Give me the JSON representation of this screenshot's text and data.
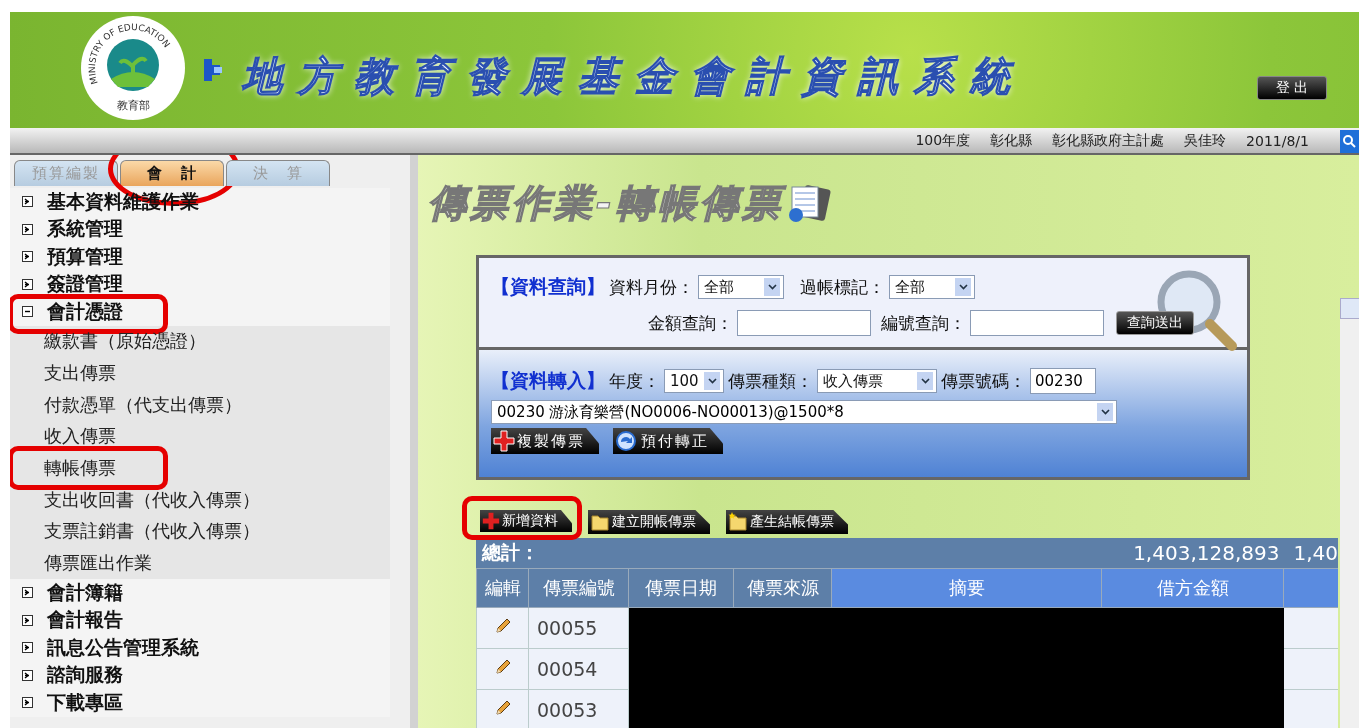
{
  "header": {
    "logo_ring_text": "MINISTRY OF EDUCATION",
    "logo_bottom_text": "教育部",
    "title": "地方教育發展基金會計資訊系統",
    "logout_button": "登 出"
  },
  "info_bar": [
    "100年度",
    "彰化縣",
    "彰化縣政府主計處",
    "吳佳玲",
    "2011/8/1"
  ],
  "tabs": [
    {
      "label": "預算編製",
      "selected": false,
      "circled": false
    },
    {
      "label": "會　計",
      "selected": true,
      "circled": true
    },
    {
      "label": "決　算",
      "selected": false,
      "circled": false
    }
  ],
  "menu": [
    {
      "label": "基本資料維護作業",
      "expanded": false,
      "boxed": false
    },
    {
      "label": "系統管理",
      "expanded": false,
      "boxed": false
    },
    {
      "label": "預算管理",
      "expanded": false,
      "boxed": false
    },
    {
      "label": "簽證管理",
      "expanded": false,
      "boxed": false
    },
    {
      "label": "會計憑證",
      "expanded": true,
      "boxed": true,
      "children": [
        {
          "label": "繳款書（原始憑證）",
          "boxed": false
        },
        {
          "label": "支出傳票",
          "boxed": false
        },
        {
          "label": "付款憑單（代支出傳票）",
          "boxed": false
        },
        {
          "label": "收入傳票",
          "boxed": false
        },
        {
          "label": "轉帳傳票",
          "boxed": true
        },
        {
          "label": "支出收回書（代收入傳票）",
          "boxed": false
        },
        {
          "label": "支票註銷書（代收入傳票）",
          "boxed": false
        },
        {
          "label": "傳票匯出作業",
          "boxed": false
        }
      ]
    },
    {
      "label": "會計簿籍",
      "expanded": false,
      "boxed": false
    },
    {
      "label": "會計報告",
      "expanded": false,
      "boxed": false
    },
    {
      "label": "訊息公告管理系統",
      "expanded": false,
      "boxed": false
    },
    {
      "label": "諮詢服務",
      "expanded": false,
      "boxed": false
    },
    {
      "label": "下載專區",
      "expanded": false,
      "boxed": false
    }
  ],
  "page_title": "傳票作業-轉帳傳票",
  "query": {
    "heading": "【資料查詢】",
    "month_label": "資料月份：",
    "month_value": "全部",
    "posted_label": "過帳標記：",
    "posted_value": "全部",
    "amount_label": "金額查詢：",
    "number_label": "編號查詢：",
    "submit_button": "查詢送出"
  },
  "import": {
    "heading": "【資料轉入】",
    "year_label": "年度：",
    "year_value": "100",
    "type_label": "傳票種類：",
    "type_value": "收入傳票",
    "voucher_label": "傳票號碼：",
    "voucher_value": "00230",
    "source_value": "00230 游泳育樂營(NO0006-NO00013)@1500*8",
    "buttons": [
      {
        "label": "複製傳票",
        "kind": "copy"
      },
      {
        "label": "預付轉正",
        "kind": "convert"
      }
    ]
  },
  "toolbar": [
    {
      "label": "新增資料",
      "kind": "add",
      "boxed": true
    },
    {
      "label": "建立開帳傳票",
      "kind": "folder",
      "boxed": false
    },
    {
      "label": "產生結帳傳票",
      "kind": "folder-star",
      "boxed": false
    }
  ],
  "table": {
    "total_label": "總計：",
    "totals": [
      "1,403,128,893",
      "1,40"
    ],
    "columns": [
      "編輯",
      "傳票編號",
      "傳票日期",
      "傳票來源",
      "摘要",
      "借方金額"
    ],
    "rows": [
      {
        "number": "00055"
      },
      {
        "number": "00054"
      },
      {
        "number": "00053"
      }
    ]
  }
}
